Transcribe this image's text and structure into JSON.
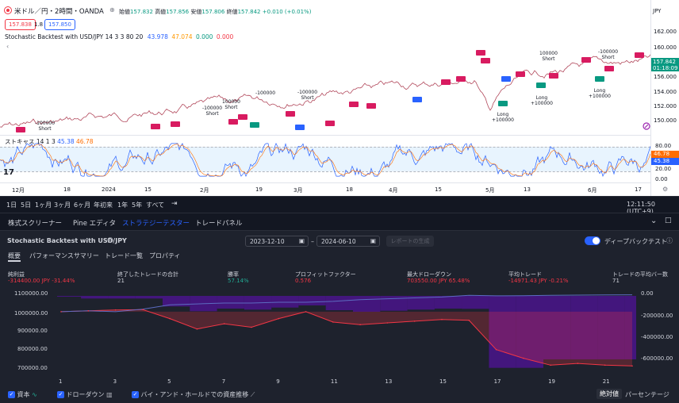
{
  "header": {
    "symbol_title": "米ドル／円・2時間・OANDA",
    "ohlc": {
      "open_label": "始値",
      "open": "157.832",
      "high_label": "高値",
      "high": "157.856",
      "low_label": "安値",
      "low": "157.806",
      "close_label": "終値",
      "close": "157.842",
      "change": "+0.010 (+0.01%)"
    },
    "sell_price": "157.838",
    "spread": "1.8",
    "buy_price": "157.850",
    "currency": "JPY"
  },
  "indicator": {
    "legend": "Stochastic Backtest with USD/JPY 14 3 3 80 20",
    "values": [
      "43.978",
      "47.074",
      "0.000",
      "0.000"
    ],
    "value_colors": [
      "#2962ff",
      "#ff9800",
      "#f23645",
      "#f23645"
    ]
  },
  "price_axis": {
    "labels": [
      "162.000",
      "160.000",
      "158.000",
      "156.000",
      "154.000",
      "152.000",
      "150.000"
    ],
    "current_price": "157.842",
    "countdown": "01:18:09"
  },
  "stoch_pane": {
    "title": "ストキャス 14 1 3",
    "k_value": "45.38",
    "d_value": "46.78",
    "axis_labels": [
      "80.00",
      "20.00",
      "0.00"
    ],
    "upper": 80,
    "lower": 20
  },
  "time_axis": {
    "labels": [
      "12月",
      "18",
      "2024",
      "15",
      "2月",
      "19",
      "3月",
      "18",
      "4月",
      "15",
      "5月",
      "13",
      "6月",
      "17"
    ]
  },
  "trade_annotations": [
    {
      "text": "-100000",
      "sub": "Short"
    },
    {
      "text": "-100000",
      "sub": "Short"
    },
    {
      "text": "100000",
      "sub": "Short"
    },
    {
      "text": "-100000",
      "sub": ""
    },
    {
      "text": "-100000",
      "sub": "Short"
    },
    {
      "text": "100000",
      "sub": "Short"
    },
    {
      "text": "-100000",
      "sub": "Short"
    },
    {
      "text": "Long",
      "sub": "+100000"
    },
    {
      "text": "Long",
      "sub": "+100000"
    },
    {
      "text": "Long",
      "sub": "+100000"
    }
  ],
  "period_bar": {
    "ranges": [
      "1日",
      "5日",
      "1ヶ月",
      "3ヶ月",
      "6ヶ月",
      "年初来",
      "1年",
      "5年",
      "すべて"
    ],
    "clock": "12:11:50 (UTC+9)"
  },
  "bottom_tabs": [
    "株式スクリーナー",
    "Pine エディタ",
    "ストラテジーテスター",
    "トレードパネル"
  ],
  "strategy": {
    "name": "Stochastic Backtest with USD/JPY",
    "date_from": "2023-12-10",
    "date_to": "2024-06-10",
    "date_separator": "–",
    "report_button": "レポートの生成",
    "deep_backtest_label": "ディープバックテスト",
    "subtabs": [
      "概要",
      "パフォーマンスサマリー",
      "トレード一覧",
      "プロパティ"
    ],
    "metrics": [
      {
        "label": "純利益",
        "value": "-314400.00 JPY",
        "extra": "-31.44%",
        "color": "neg"
      },
      {
        "label": "終了したトレードの合計",
        "value": "21",
        "extra": "",
        "color": "plain"
      },
      {
        "label": "勝率",
        "value": "57.14%",
        "extra": "",
        "color": "pos"
      },
      {
        "label": "プロフィットファクター",
        "value": "0.576",
        "extra": "",
        "color": "neg"
      },
      {
        "label": "最大ドローダウン",
        "value": "703550.00 JPY",
        "extra": "65.48%",
        "color": "neg"
      },
      {
        "label": "平均トレード",
        "value": "-14971.43 JPY",
        "extra": "-0.21%",
        "color": "neg"
      },
      {
        "label": "トレードの平均バー数",
        "value": "71",
        "extra": "",
        "color": "plain"
      }
    ],
    "left_axis": [
      "1100000.00",
      "1000000.00",
      "900000.00",
      "800000.00",
      "700000.00"
    ],
    "right_axis": [
      "0.00",
      "-200000.00",
      "-400000.00",
      "-600000.00"
    ],
    "x_axis": [
      "1",
      "3",
      "5",
      "7",
      "9",
      "11",
      "13",
      "15",
      "17",
      "19",
      "21"
    ],
    "legend": {
      "equity": "資本",
      "drawdown": "ドローダウン",
      "buy_hold": "バイ・アンド・ホールドでの資産推移"
    },
    "toggle_absolute": "絶対値",
    "toggle_percent": "パーセンテージ"
  },
  "chart_data": {
    "type": "area",
    "x": [
      1,
      2,
      3,
      4,
      5,
      6,
      7,
      8,
      9,
      10,
      11,
      12,
      13,
      14,
      15,
      16,
      17,
      18,
      19,
      20,
      21,
      22
    ],
    "ylim": [
      650000,
      1110000
    ],
    "series": [
      {
        "name": "資本",
        "values": [
          1000000,
          1005000,
          1010000,
          1012000,
          960000,
          900000,
          930000,
          910000,
          960000,
          1000000,
          940000,
          925000,
          935000,
          945000,
          955000,
          950000,
          780000,
          730000,
          690000,
          700000,
          690000,
          685600
        ]
      },
      {
        "name": "バイ・アンド・ホールドでの資産推移",
        "values": [
          1000000,
          1005000,
          1000000,
          1015000,
          1040000,
          1045000,
          1050000,
          1050000,
          1055000,
          1055000,
          1060000,
          1070000,
          1075000,
          1080000,
          1085000,
          1095000,
          1092000,
          1093000,
          1095000,
          1096000,
          1097000,
          1098000
        ]
      },
      {
        "name": "ドローダウン",
        "values": [
          0,
          -25000,
          -25000,
          -25000,
          -100000,
          -145000,
          -120000,
          -130000,
          -110000,
          -90000,
          -135000,
          -150000,
          -140000,
          -130000,
          -120000,
          -122000,
          -680000,
          -680000,
          -600000,
          -600000,
          -600000,
          -600000
        ]
      }
    ],
    "right_ylim": [
      -720000,
      30000
    ]
  }
}
